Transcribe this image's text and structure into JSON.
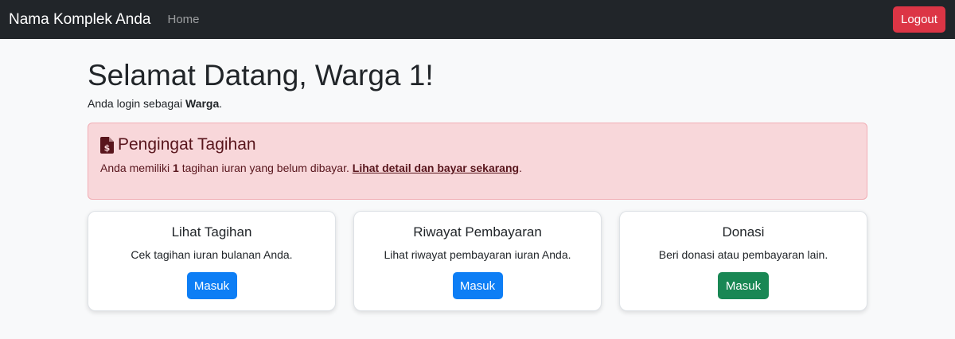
{
  "navbar": {
    "brand": "Nama Komplek Anda",
    "home_label": "Home",
    "logout_label": "Logout"
  },
  "main": {
    "title": "Selamat Datang, Warga 1!",
    "login_prefix": "Anda login sebagai ",
    "login_role": "Warga",
    "login_suffix": "."
  },
  "alert": {
    "icon": "file-invoice-dollar-icon",
    "heading": "Pengingat Tagihan",
    "text_prefix": "Anda memiliki ",
    "count": "1",
    "text_middle": " tagihan iuran yang belum dibayar. ",
    "link_label": "Lihat detail dan bayar sekarang",
    "text_suffix": "."
  },
  "cards": [
    {
      "title": "Lihat Tagihan",
      "text": "Cek tagihan iuran bulanan Anda.",
      "button": "Masuk",
      "button_color": "#0d7ef5"
    },
    {
      "title": "Riwayat Pembayaran",
      "text": "Lihat riwayat pembayaran iuran Anda.",
      "button": "Masuk",
      "button_color": "#0d7ef5"
    },
    {
      "title": "Donasi",
      "text": "Beri donasi atau pembayaran lain.",
      "button": "Masuk",
      "button_color": "#198754"
    }
  ],
  "colors": {
    "navbar_bg": "#212529",
    "danger": "#dc3545",
    "alert_bg": "#f8d7da",
    "alert_text": "#58151c"
  }
}
